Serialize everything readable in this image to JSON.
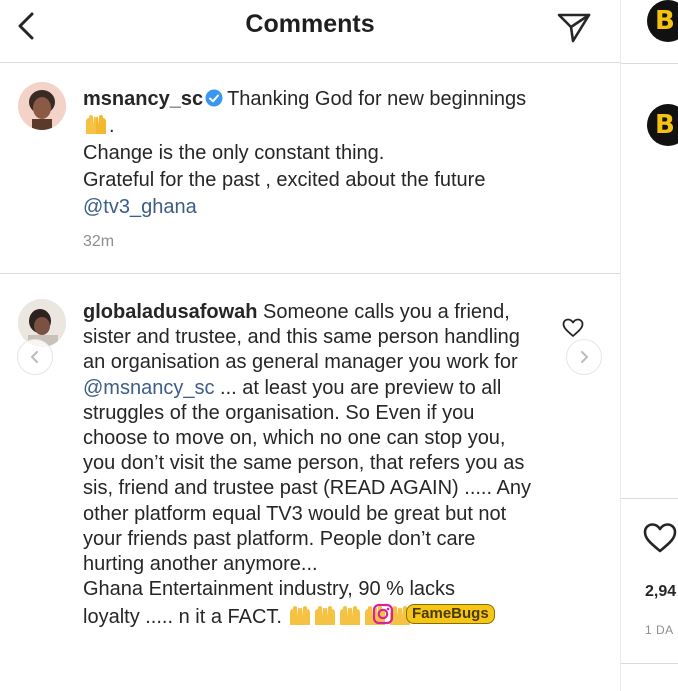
{
  "header": {
    "title": "Comments"
  },
  "caption": {
    "username": "msnancy_sc",
    "line1": "Thanking God for new beginnings",
    "line1_end": ".",
    "line2": "Change is the only constant thing.",
    "line3": "Grateful for the past , excited about the future",
    "mention": "@tv3_ghana",
    "time": "32m"
  },
  "comment": {
    "username": "globaladusafowah",
    "text_before_mention": " Someone calls you a friend, sister and trustee, and this same person handling an organisation as general manager you work for ",
    "mention": "@msnancy_sc",
    "text_after_mention": " ... at least you are preview to all struggles of the organisation. So Even if you choose to move on, which no one can stop you, you don’t visit the same person, that refers you as sis, friend and trustee past (READ AGAIN) ..... Any other platform equal TV3 would be great but not your friends past platform. People don’t care hurting another anymore...",
    "last_line1": "Ghana Entertainment industry, 90 % lacks",
    "last_line2": "loyalty ..... n it a FACT."
  },
  "watermark": {
    "text": "FameBugs"
  },
  "right_panel": {
    "logo_letter": "B",
    "likes": "2,94",
    "date": "1 DA"
  },
  "colors": {
    "mention": "#3b5d86",
    "verified": "#3897f0",
    "muted": "#8e8e8e",
    "logo_bg": "#111111",
    "logo_fg": "#f5c20e"
  },
  "icons": {
    "back": "chevron-left-icon",
    "send": "paper-plane-icon",
    "like": "heart-icon",
    "verified": "verified-badge-icon",
    "instagram": "instagram-icon",
    "praise": "raised-hands-emoji"
  }
}
